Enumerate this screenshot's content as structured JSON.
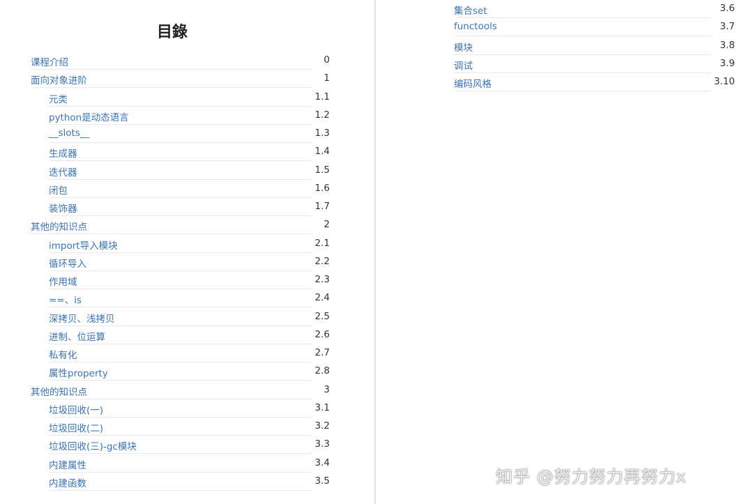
{
  "title": "目錄",
  "left_items": [
    {
      "label": "课程介绍",
      "num": "0",
      "level": 0
    },
    {
      "label": "面向对象进阶",
      "num": "1",
      "level": 0
    },
    {
      "label": "元类",
      "num": "1.1",
      "level": 1
    },
    {
      "label": "python是动态语言",
      "num": "1.2",
      "level": 1
    },
    {
      "label": "__slots__",
      "num": "1.3",
      "level": 1
    },
    {
      "label": "生成器",
      "num": "1.4",
      "level": 1
    },
    {
      "label": "迭代器",
      "num": "1.5",
      "level": 1
    },
    {
      "label": "闭包",
      "num": "1.6",
      "level": 1
    },
    {
      "label": "装饰器",
      "num": "1.7",
      "level": 1
    },
    {
      "label": "其他的知识点",
      "num": "2",
      "level": 0
    },
    {
      "label": "import导入模块",
      "num": "2.1",
      "level": 1
    },
    {
      "label": "循环导入",
      "num": "2.2",
      "level": 1
    },
    {
      "label": "作用域",
      "num": "2.3",
      "level": 1
    },
    {
      "label": "==、is",
      "num": "2.4",
      "level": 1
    },
    {
      "label": "深拷贝、浅拷贝",
      "num": "2.5",
      "level": 1
    },
    {
      "label": "进制、位运算",
      "num": "2.6",
      "level": 1
    },
    {
      "label": "私有化",
      "num": "2.7",
      "level": 1
    },
    {
      "label": "属性property",
      "num": "2.8",
      "level": 1
    },
    {
      "label": "其他的知识点",
      "num": "3",
      "level": 0
    },
    {
      "label": "垃圾回收(一)",
      "num": "3.1",
      "level": 1
    },
    {
      "label": "垃圾回收(二)",
      "num": "3.2",
      "level": 1
    },
    {
      "label": "垃圾回收(三)-gc模块",
      "num": "3.3",
      "level": 1
    },
    {
      "label": "内建属性",
      "num": "3.4",
      "level": 1
    },
    {
      "label": "内建函数",
      "num": "3.5",
      "level": 1
    }
  ],
  "right_items": [
    {
      "label": "集合set",
      "num": "3.6",
      "level": 1
    },
    {
      "label": "functools",
      "num": "3.7",
      "level": 1
    },
    {
      "label": "模块",
      "num": "3.8",
      "level": 1
    },
    {
      "label": "调试",
      "num": "3.9",
      "level": 1
    },
    {
      "label": "编码风格",
      "num": "3.10",
      "level": 1
    }
  ],
  "watermark": "知乎 @努力努力再努力x",
  "colors": {
    "link": "#3a73b6",
    "rule": "#e9e9e9",
    "divider": "#e2e2e2"
  }
}
